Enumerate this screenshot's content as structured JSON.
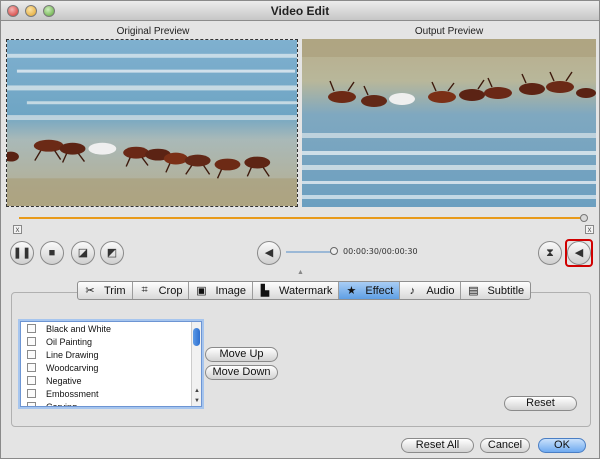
{
  "window": {
    "title": "Video Edit"
  },
  "preview": {
    "original_label": "Original Preview",
    "output_label": "Output Preview"
  },
  "playback": {
    "time": "00:00:30/00:00:30",
    "volume_percent": 100,
    "progress_percent": 100
  },
  "tabs": [
    {
      "label": "Trim",
      "icon": "scissors-icon",
      "glyph": "✂"
    },
    {
      "label": "Crop",
      "icon": "crop-icon",
      "glyph": "⌗"
    },
    {
      "label": "Image",
      "icon": "image-icon",
      "glyph": "▣"
    },
    {
      "label": "Watermark",
      "icon": "watermark-icon",
      "glyph": "▙"
    },
    {
      "label": "Effect",
      "icon": "star-icon",
      "glyph": "★",
      "active": true
    },
    {
      "label": "Audio",
      "icon": "music-note-icon",
      "glyph": "♪"
    },
    {
      "label": "Subtitle",
      "icon": "subtitle-icon",
      "glyph": "▤"
    }
  ],
  "effects": [
    "Black and White",
    "Oil Painting",
    "Line Drawing",
    "Woodcarving",
    "Negative",
    "Embossment",
    "Carving"
  ],
  "buttons": {
    "move_up": "Move Up",
    "move_down": "Move Down",
    "reset": "Reset",
    "reset_all": "Reset All",
    "cancel": "Cancel",
    "ok": "OK"
  },
  "colors": {
    "accent": "#5f9fe4",
    "timeline": "#e89a1a",
    "selection_outline": "#d00000"
  }
}
